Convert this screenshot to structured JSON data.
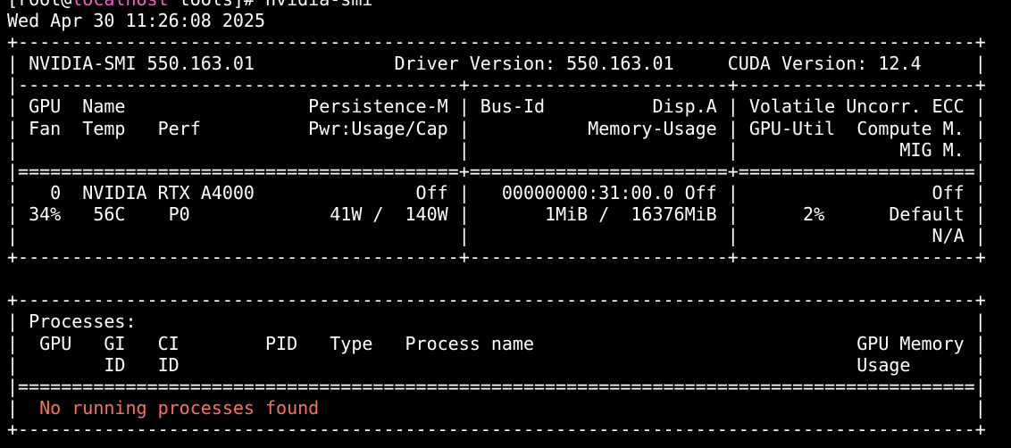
{
  "terminal": {
    "prompt": {
      "open_bracket": "[",
      "user_at": "root@",
      "host": "localhost",
      "path_and_sign": " tools]# ",
      "command": "nvidia-smi"
    },
    "timestamp": "Wed Apr 30 11:26:08 2025",
    "colors": {
      "background": "#000000",
      "text": "#ffffff",
      "hostname": "#ff5cc6",
      "no_process_message": "#ff6f61"
    },
    "lines": [
      "+-----------------------------------------------------------------------------------------+",
      "| NVIDIA-SMI 550.163.01             Driver Version: 550.163.01     CUDA Version: 12.4     |",
      "|-----------------------------------------+------------------------+----------------------+",
      "| GPU  Name                 Persistence-M | Bus-Id          Disp.A | Volatile Uncorr. ECC |",
      "| Fan  Temp   Perf          Pwr:Usage/Cap |           Memory-Usage | GPU-Util  Compute M. |",
      "|                                         |                        |               MIG M. |",
      "|=========================================+========================+======================|",
      "|   0  NVIDIA RTX A4000               Off |   00000000:31:00.0 Off |                  Off |",
      "| 34%   56C    P0             41W /  140W |       1MiB /  16376MiB |      2%      Default |",
      "|                                         |                        |                  N/A |",
      "+-----------------------------------------+------------------------+----------------------+",
      "",
      "+-----------------------------------------------------------------------------------------+",
      "| Processes:                                                                              |",
      "|  GPU   GI   CI        PID   Type   Process name                              GPU Memory |",
      "|        ID   ID                                                               Usage      |",
      "|=========================================================================================|"
    ],
    "no_process_prefix": "|  ",
    "no_process_message": "No running processes found",
    "no_process_suffix": "                                                             |",
    "last_line": "+-----------------------------------------------------------------------------------------+"
  }
}
